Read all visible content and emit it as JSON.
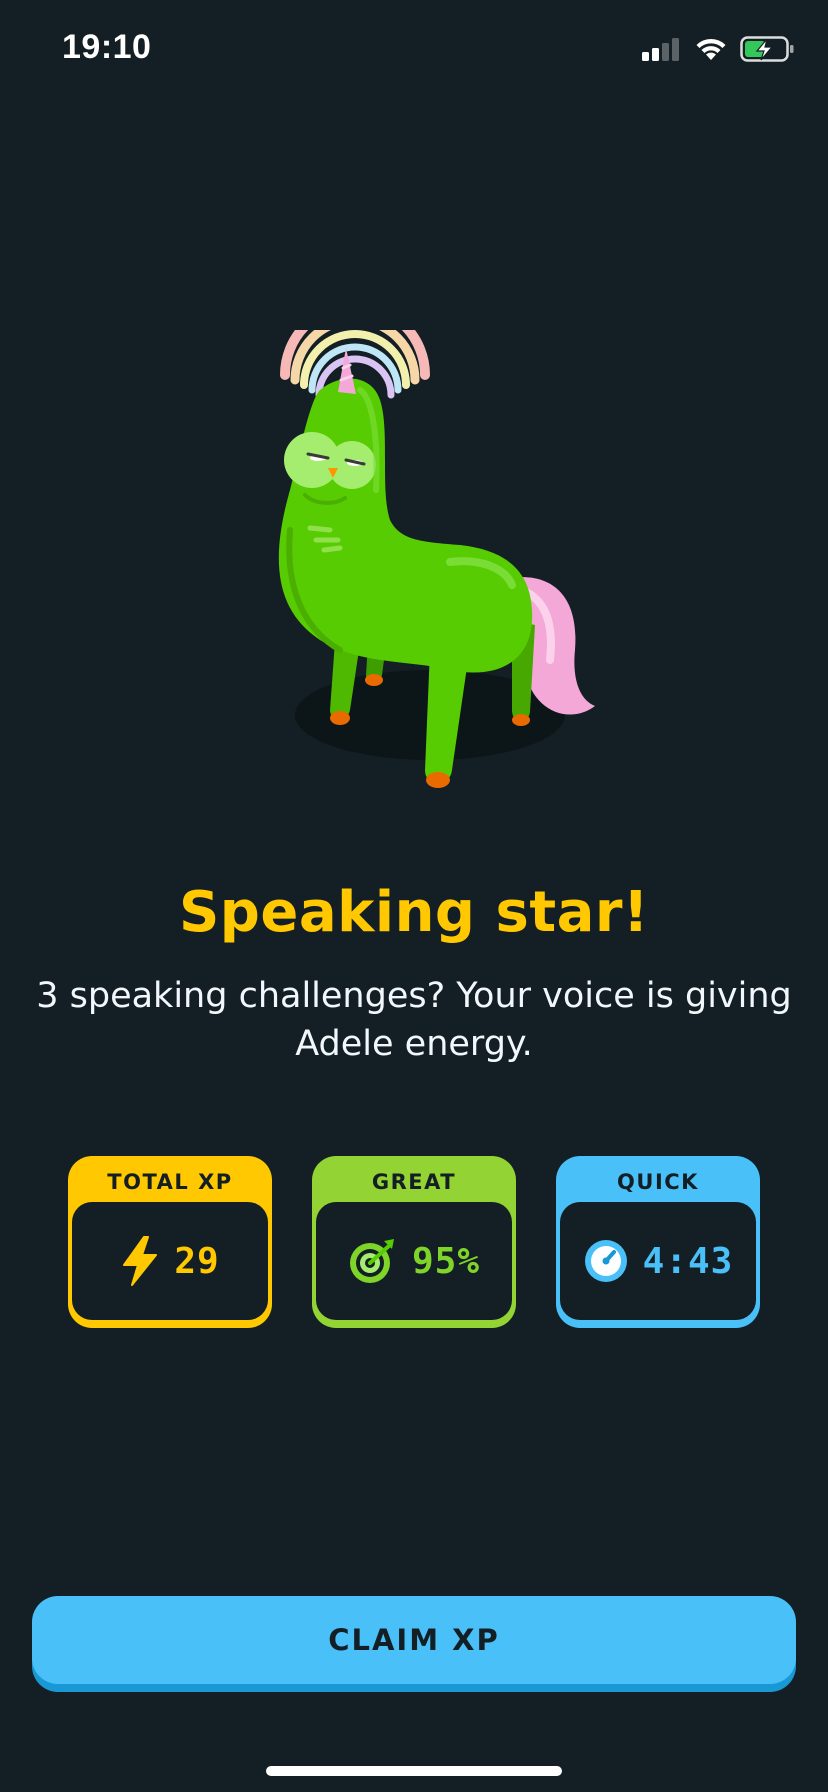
{
  "status_bar": {
    "time": "19:10"
  },
  "result": {
    "headline": "Speaking star!",
    "subtext": "3 speaking challenges? Your voice is giving Adele energy."
  },
  "stats": [
    {
      "label": "TOTAL XP",
      "value": "29",
      "icon": "lightning-bolt-icon",
      "color": "#ffc800"
    },
    {
      "label": "GREAT",
      "value": "95%",
      "icon": "target-icon",
      "color": "#93d333"
    },
    {
      "label": "QUICK",
      "value": "4:43",
      "icon": "stopwatch-icon",
      "color": "#49c0f8"
    }
  ],
  "actions": {
    "claim_label": "CLAIM XP"
  },
  "colors": {
    "background": "#131f24",
    "headline": "#ffc800",
    "button": "#49c0f8",
    "button_shadow": "#1899d6"
  }
}
